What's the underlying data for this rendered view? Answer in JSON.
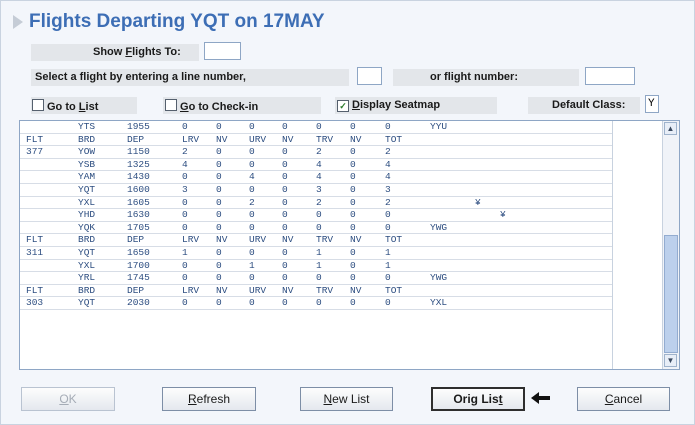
{
  "title": "Flights Departing YQT on 17MAY",
  "show_flights": {
    "label_pre": "Show ",
    "label_ul": "F",
    "label_post": "lights To:",
    "value": ""
  },
  "select_prompt": "Select a flight by entering a line number,",
  "line_number_value": "",
  "flight_number_label": "or flight number:",
  "flight_number_value": "",
  "options": {
    "goto_list": {
      "pre": "Go to ",
      "ul": "L",
      "post": "ist",
      "checked": false
    },
    "goto_checkin": {
      "ul": "G",
      "post": "o to Check-in",
      "checked": false
    },
    "display_seatmap": {
      "ul": "D",
      "post": "isplay Seatmap",
      "checked": true,
      "mark": "✓"
    },
    "default_class_label": "Default Class:",
    "default_class_value": "Y"
  },
  "columns": [
    "FLT",
    "BRD",
    "DEP",
    "LRV",
    "NV",
    "URV",
    "NV",
    "TRV",
    "NV",
    "TOT"
  ],
  "rows": [
    [
      "",
      "YTS",
      "1955",
      "0",
      "0",
      "0",
      "0",
      "0",
      "0",
      "0",
      "YYU",
      ""
    ],
    [
      "FLT",
      "BRD",
      "DEP",
      "LRV",
      "NV",
      "URV",
      "NV",
      "TRV",
      "NV",
      "TOT",
      "",
      ""
    ],
    [
      "377",
      "YOW",
      "1150",
      "2",
      "0",
      "0",
      "0",
      "2",
      "0",
      "2",
      "",
      ""
    ],
    [
      "",
      "YSB",
      "1325",
      "4",
      "0",
      "0",
      "0",
      "4",
      "0",
      "4",
      "",
      ""
    ],
    [
      "",
      "YAM",
      "1430",
      "0",
      "0",
      "4",
      "0",
      "4",
      "0",
      "4",
      "",
      ""
    ],
    [
      "",
      "YQT",
      "1600",
      "3",
      "0",
      "0",
      "0",
      "3",
      "0",
      "3",
      "",
      ""
    ],
    [
      "",
      "YXL",
      "1605",
      "0",
      "0",
      "2",
      "0",
      "2",
      "0",
      "2",
      "",
      "¥"
    ],
    [
      "",
      "YHD",
      "1630",
      "0",
      "0",
      "0",
      "0",
      "0",
      "0",
      "0",
      "",
      "¥"
    ],
    [
      "",
      "YQK",
      "1705",
      "0",
      "0",
      "0",
      "0",
      "0",
      "0",
      "0",
      "YWG",
      ""
    ],
    [
      "FLT",
      "BRD",
      "DEP",
      "LRV",
      "NV",
      "URV",
      "NV",
      "TRV",
      "NV",
      "TOT",
      "",
      ""
    ],
    [
      "311",
      "YQT",
      "1650",
      "1",
      "0",
      "0",
      "0",
      "1",
      "0",
      "1",
      "",
      ""
    ],
    [
      "",
      "YXL",
      "1700",
      "0",
      "0",
      "1",
      "0",
      "1",
      "0",
      "1",
      "",
      ""
    ],
    [
      "",
      "YRL",
      "1745",
      "0",
      "0",
      "0",
      "0",
      "0",
      "0",
      "0",
      "YWG",
      ""
    ],
    [
      "FLT",
      "BRD",
      "DEP",
      "LRV",
      "NV",
      "URV",
      "NV",
      "TRV",
      "NV",
      "TOT",
      "",
      ""
    ],
    [
      "303",
      "YQT",
      "2030",
      "0",
      "0",
      "0",
      "0",
      "0",
      "0",
      "0",
      "YXL",
      ""
    ]
  ],
  "scrollbar": {
    "up": "▲",
    "down": "▼"
  },
  "buttons": {
    "ok": {
      "ul": "O",
      "post": "K"
    },
    "refresh": {
      "ul": "R",
      "post": "efresh"
    },
    "new_list": {
      "ul": "N",
      "post": "ew List"
    },
    "orig_list": {
      "pre": "Orig Lis",
      "ul": "t"
    },
    "cancel": {
      "ul": "C",
      "post": "ancel"
    }
  },
  "arrow_icon": "arrow-left-icon"
}
